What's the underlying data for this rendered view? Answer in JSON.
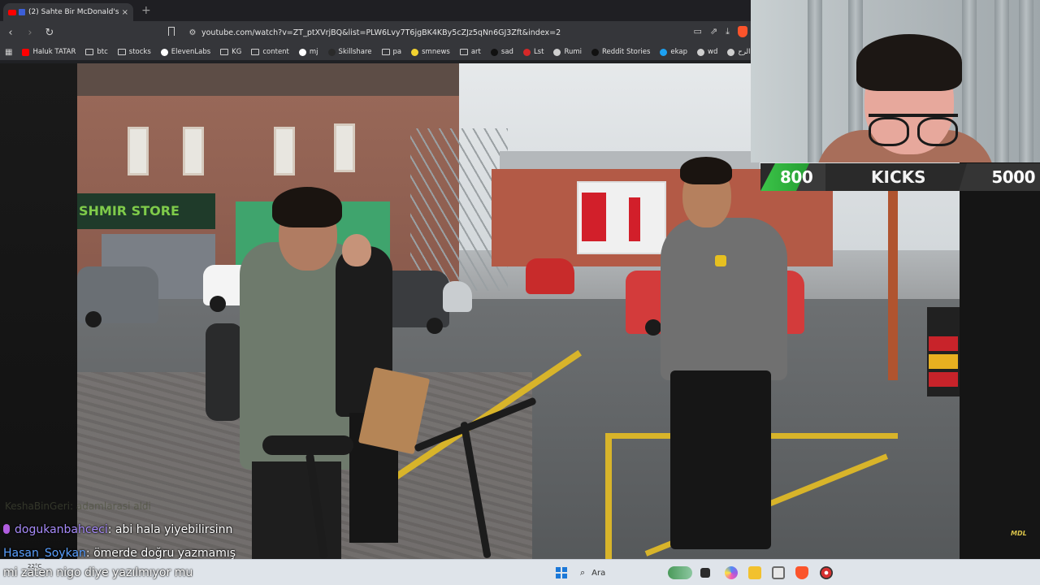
{
  "browser": {
    "tab_title": "(2) Sahte Bir McDonald's Ara...",
    "tab_close": "×",
    "new_tab": "+",
    "url": "youtube.com/watch?v=ZT_ptXVrjBQ&list=PLW6Lvy7T6jgBK4KBy5cZJz5qNn6GJ3Zft&index=2",
    "bookmarks": [
      {
        "label": "Haluk TATAR",
        "icon": "youtube-icon",
        "color": "#ff0000"
      },
      {
        "label": "btc",
        "icon": "folder-icon"
      },
      {
        "label": "stocks",
        "icon": "folder-icon"
      },
      {
        "label": "ElevenLabs",
        "icon": "elevenlabs-icon",
        "color": "#ffffff"
      },
      {
        "label": "KG",
        "icon": "folder-icon"
      },
      {
        "label": "content",
        "icon": "folder-icon"
      },
      {
        "label": "mj",
        "icon": "github-icon",
        "color": "#ffffff"
      },
      {
        "label": "Skillshare",
        "icon": "skillshare-icon",
        "color": "#2a2a2a"
      },
      {
        "label": "pa",
        "icon": "folder-icon"
      },
      {
        "label": "smnews",
        "icon": "smiley-icon",
        "color": "#f2d230"
      },
      {
        "label": "art",
        "icon": "folder-icon"
      },
      {
        "label": "sad",
        "icon": "feather-icon",
        "color": "#111111"
      },
      {
        "label": "Lst",
        "icon": "s-logo-icon",
        "color": "#d62828"
      },
      {
        "label": "Rumi",
        "icon": "globe-icon",
        "color": "#cfcfcf"
      },
      {
        "label": "Reddit Stories",
        "icon": "d-logo-icon",
        "color": "#111111"
      },
      {
        "label": "ekap",
        "icon": "bird-icon",
        "color": "#1da1f2"
      },
      {
        "label": "wd",
        "icon": "wiki-icon",
        "color": "#cfcfcf"
      },
      {
        "label": "الرحمن الرح...",
        "icon": "book-icon",
        "color": "#cfcfcf"
      }
    ]
  },
  "stream_overlay": {
    "kicks_left": "800",
    "kicks_label": "KICKS",
    "kicks_right": "5000",
    "store_sign": "SHMIR STORE",
    "watermark": "MDL"
  },
  "chat": {
    "faded_line": "KeshaBinGeri: adamlarasi aldi",
    "messages": [
      {
        "user": "dogukanbahceci",
        "user_color": "#a78bfa",
        "text": ": abi hala yiyebilirsinn"
      },
      {
        "user": "Hasan_Soykan",
        "user_color": "#5aa0ff",
        "text": ": ömerde doğru yazmamış"
      },
      {
        "user": "",
        "user_color": "#ffffff",
        "text": "mi zaten nigo diye yazılmıyor mu"
      }
    ]
  },
  "taskbar": {
    "weather": "22°C",
    "search_label": "Ara"
  },
  "colors": {
    "chrome_bg": "#35363a",
    "taskbar_bg": "#dfe4ea",
    "kicks_green": "#3cd44a"
  }
}
